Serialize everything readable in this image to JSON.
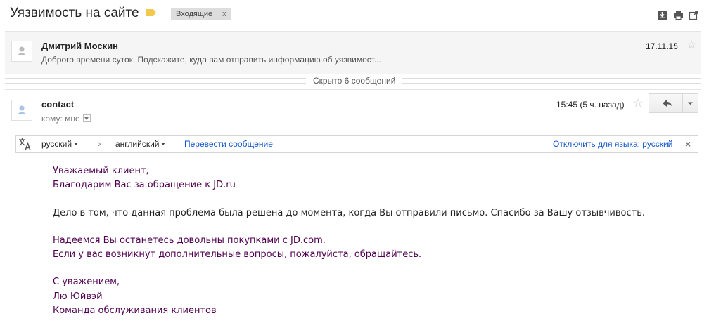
{
  "thread": {
    "subject": "Уязвимость на сайте",
    "label_chip": "Входящие",
    "chip_close": "x",
    "label_color": "#f2c94c"
  },
  "collapsed_message": {
    "sender": "Дмитрий Москин",
    "snippet": "Доброго времени суток. Подскажите, куда вам отправить информацию об уязвимост...",
    "date": "17.11.15"
  },
  "hidden_messages": {
    "text": "Скрыто 6 сообщений"
  },
  "message": {
    "sender": "contact",
    "to_label": "кому: мне",
    "time": "15:45 (5 ч. назад)"
  },
  "translate_bar": {
    "source_lang": "русский",
    "arrow": "›",
    "target_lang": "английский",
    "translate_link": "Перевести сообщение",
    "disable_link": "Отключить для языка: русский",
    "close": "×"
  },
  "body": {
    "lines": [
      "Уважаемый клиент,",
      "Благодарим Вас за обращение к JD.ru",
      "Дело в том, что данная проблема была решена до момента, когда Вы отправили письмо. Спасибо за Вашу отзывчивость.",
      "Надеемся Вы останетесь довольны покупками с JD.com.",
      "Если у вас возникнут дополнительные вопросы, пожалуйста, обращайтесь.",
      "С уважением,",
      "Лю Юйвэй",
      "Команда обслуживания клиентов"
    ]
  },
  "icons": {
    "toolbar": [
      "download-icon",
      "print-icon",
      "new-window-icon"
    ],
    "star": "star-icon",
    "reply": "reply-icon",
    "more": "more-options-icon",
    "translate": "translate-icon"
  },
  "colors": {
    "body_text": "#500050",
    "link": "#1155cc"
  }
}
